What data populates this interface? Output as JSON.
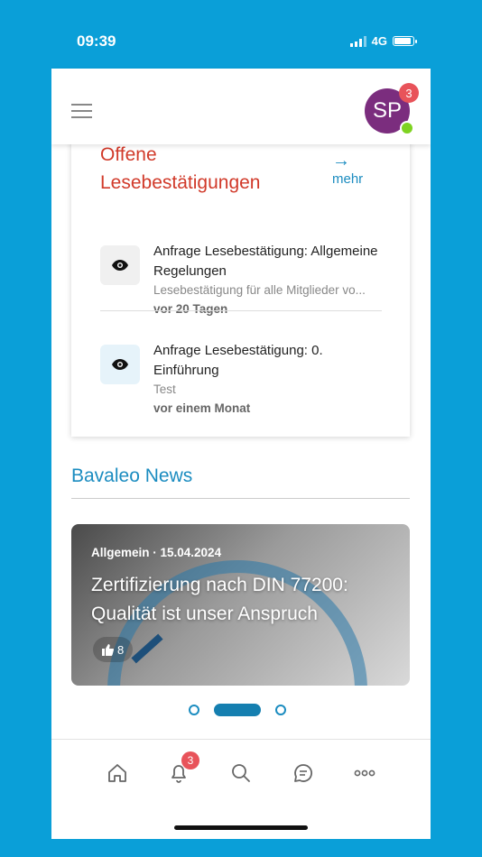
{
  "status_bar": {
    "time": "09:39",
    "network": "4G"
  },
  "header": {
    "avatar_initials": "SP",
    "notification_count": "3"
  },
  "reads_card": {
    "title": "Offene Lesebestätigungen",
    "more_arrow": "→",
    "more_label": "mehr",
    "items": [
      {
        "title": "Anfrage Lesebestätigung: Allgemeine Regelungen",
        "subtitle": "Lesebestätigung für alle Mitglieder vo...",
        "time": "vor 20 Tagen"
      },
      {
        "title": "Anfrage Lesebestätigung: 0. Einführung",
        "subtitle": "Test",
        "time": "vor einem Monat"
      }
    ]
  },
  "news": {
    "section_title": "Bavaleo News",
    "card": {
      "category_date": "Allgemein · 15.04.2024",
      "headline": "Zertifizierung nach DIN 77200: Qualität ist unser Anspruch",
      "likes": "8"
    },
    "carousel_pages": 3,
    "active_page": 2
  },
  "tabbar": {
    "items": [
      "home-icon",
      "bell-icon",
      "search-icon",
      "chat-icon",
      "more-icon"
    ],
    "bell_badge": "3"
  },
  "colors": {
    "brand_blue": "#0a9fd8",
    "accent_red": "#d13a2a",
    "avatar": "#7b2d7e",
    "badge": "#e8535a",
    "link": "#1b8cc0"
  }
}
